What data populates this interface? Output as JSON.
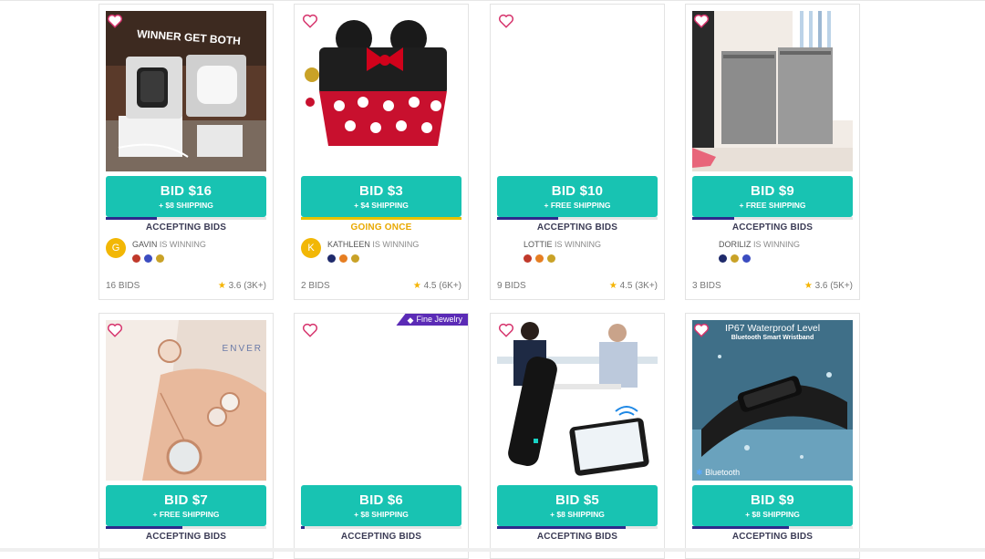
{
  "cards": [
    {
      "bid": "BID $16",
      "shipping": "+ $8 SHIPPING",
      "progress": 0.32,
      "status": "ACCEPTING BIDS",
      "avatar": "G",
      "winner": "GAVIN",
      "winning_text": "IS WINNING",
      "bids": "16 BIDS",
      "rating": "3.6 (3K+)",
      "overlay": "WINNER GET BOTH"
    },
    {
      "bid": "BID $3",
      "shipping": "+ $4 SHIPPING",
      "progress": 1.0,
      "status": "GOING ONCE",
      "avatar": "K",
      "winner": "KATHLEEN",
      "winning_text": "IS WINNING",
      "bids": "2 BIDS",
      "rating": "4.5 (6K+)"
    },
    {
      "bid": "BID $10",
      "shipping": "+ FREE SHIPPING",
      "progress": 0.38,
      "status": "ACCEPTING BIDS",
      "avatar": "",
      "winner": "LOTTIE",
      "winning_text": "IS WINNING",
      "bids": "9 BIDS",
      "rating": "4.5 (3K+)"
    },
    {
      "bid": "BID $9",
      "shipping": "+ FREE SHIPPING",
      "progress": 0.26,
      "status": "ACCEPTING BIDS",
      "avatar": "",
      "winner": "DORILIZ",
      "winning_text": "IS WINNING",
      "bids": "3 BIDS",
      "rating": "3.6 (5K+)"
    },
    {
      "bid": "BID $7",
      "shipping": "+ FREE SHIPPING",
      "progress": 0.48,
      "status": "ACCEPTING BIDS",
      "overlay": "ENVER"
    },
    {
      "bid": "BID $6",
      "shipping": "+ $8 SHIPPING",
      "progress": 0.02,
      "status": "ACCEPTING BIDS",
      "ribbon": "Fine Jewelry"
    },
    {
      "bid": "BID $5",
      "shipping": "+ $8 SHIPPING",
      "progress": 0.8,
      "status": "ACCEPTING BIDS"
    },
    {
      "bid": "BID $9",
      "shipping": "+ $8 SHIPPING",
      "progress": 0.6,
      "status": "ACCEPTING BIDS",
      "overlay_title": "IP67 Waterproof Level",
      "overlay_sub": "Bluetooth Smart Wristband",
      "overlay_bt": "Bluetooth"
    }
  ],
  "colors": {
    "bid_button": "#18c3b2",
    "progress": "#2e2a8c",
    "going_once": "#e8a800",
    "heart": "#d6336c",
    "ribbon": "#5b2bb6",
    "star": "#f5b400"
  }
}
